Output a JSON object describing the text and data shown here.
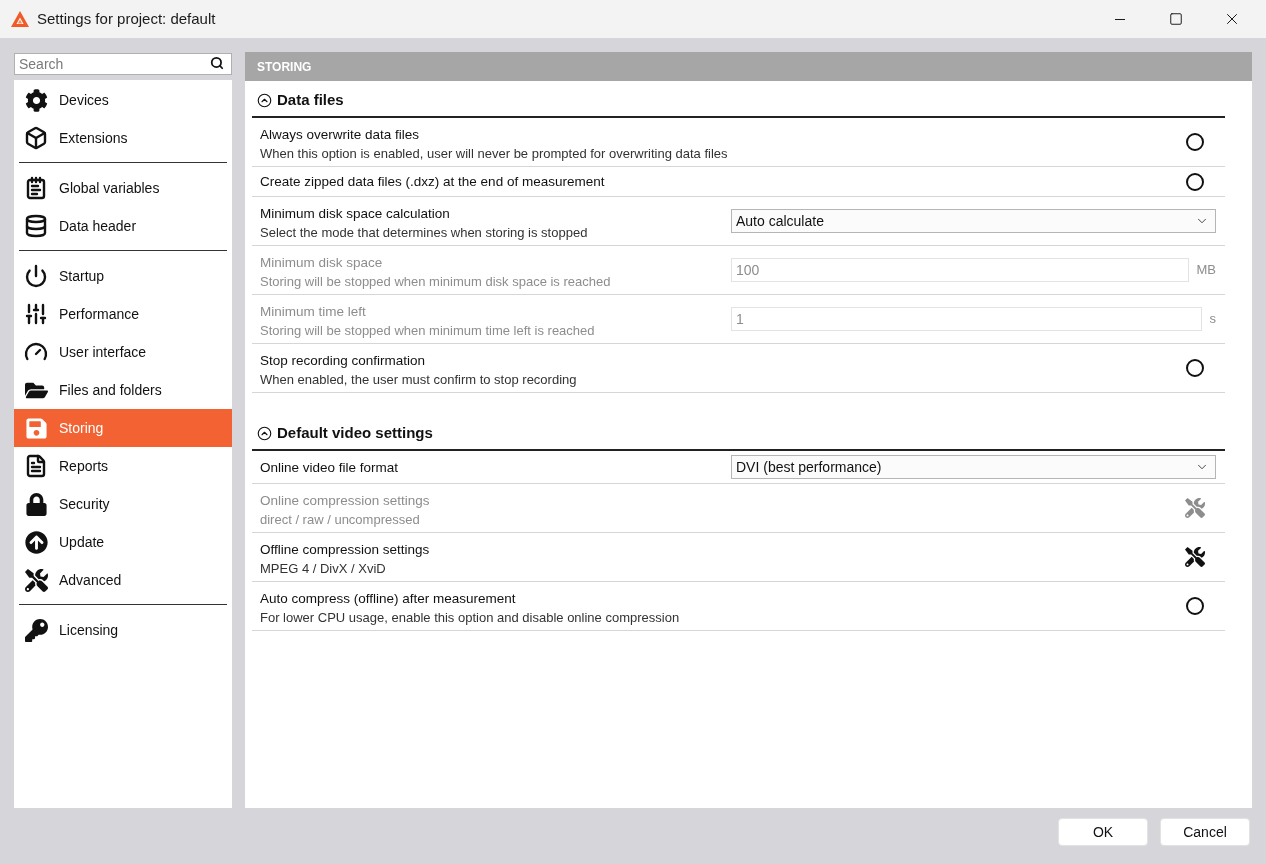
{
  "window": {
    "title": "Settings for project: default"
  },
  "sidebar": {
    "search": {
      "placeholder": "Search"
    },
    "groups": [
      {
        "items": [
          {
            "label": "Devices",
            "selected": false
          },
          {
            "label": "Extensions",
            "selected": false
          }
        ]
      },
      {
        "items": [
          {
            "label": "Global variables",
            "selected": false
          },
          {
            "label": "Data header",
            "selected": false
          }
        ]
      },
      {
        "items": [
          {
            "label": "Startup",
            "selected": false
          },
          {
            "label": "Performance",
            "selected": false
          },
          {
            "label": "User interface",
            "selected": false
          },
          {
            "label": "Files and folders",
            "selected": false
          },
          {
            "label": "Storing",
            "selected": true
          },
          {
            "label": "Reports",
            "selected": false
          },
          {
            "label": "Security",
            "selected": false
          },
          {
            "label": "Update",
            "selected": false
          },
          {
            "label": "Advanced",
            "selected": false
          }
        ]
      },
      {
        "items": [
          {
            "label": "Licensing",
            "selected": false
          }
        ]
      }
    ]
  },
  "panel": {
    "title": "STORING",
    "sections": [
      {
        "title": "Data files",
        "expanded": true,
        "rows": [
          {
            "kind": "toggle",
            "label": "Always overwrite data files",
            "description": "When this option is enabled, user will never be prompted for overwriting data files",
            "disabled": false,
            "checked": false
          },
          {
            "kind": "toggle",
            "label": "Create zipped data files (.dxz) at the end of measurement",
            "disabled": false,
            "checked": false
          },
          {
            "kind": "select",
            "label": "Minimum disk space calculation",
            "description": "Select the mode that determines when storing is stopped",
            "disabled": false,
            "value": "Auto calculate"
          },
          {
            "kind": "number",
            "label": "Minimum disk space",
            "description": "Storing will be stopped when minimum disk space is reached",
            "disabled": true,
            "value": "100",
            "unit": "MB"
          },
          {
            "kind": "number",
            "label": "Minimum time left",
            "description": "Storing will be stopped when minimum time left is reached",
            "disabled": true,
            "value": "1",
            "unit": "s"
          },
          {
            "kind": "toggle",
            "label": "Stop recording confirmation",
            "description": "When enabled, the user must confirm to stop recording",
            "disabled": false,
            "checked": false
          }
        ]
      },
      {
        "title": "Default video settings",
        "expanded": true,
        "rows": [
          {
            "kind": "select",
            "label": "Online video file format",
            "disabled": false,
            "value": "DVI (best performance)"
          },
          {
            "kind": "tool",
            "label": "Online compression settings",
            "description": "direct / raw / uncompressed",
            "disabled": true
          },
          {
            "kind": "tool",
            "label": "Offline compression settings",
            "description": "MPEG 4 / DivX / XviD",
            "disabled": false
          },
          {
            "kind": "toggle",
            "label": "Auto compress (offline) after measurement",
            "description": "For lower CPU usage, enable this option and disable online compression",
            "disabled": false,
            "checked": false
          }
        ]
      }
    ]
  },
  "buttons": [
    "OK",
    "Cancel"
  ]
}
